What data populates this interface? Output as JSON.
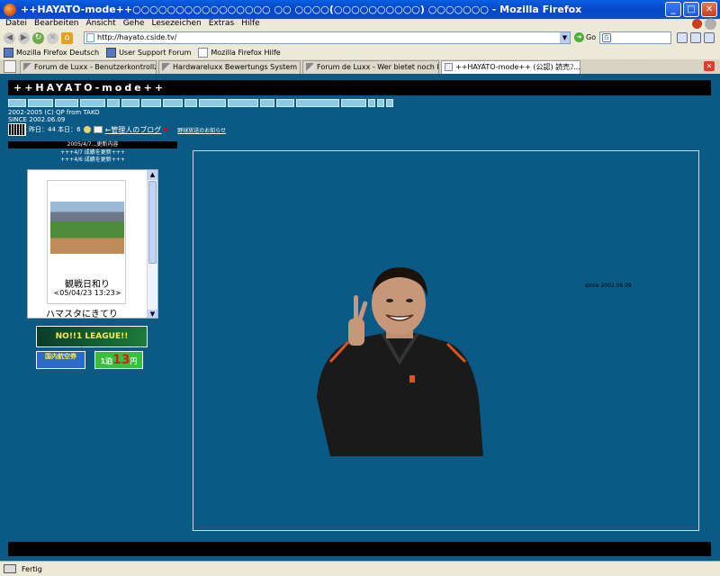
{
  "window": {
    "title": "++HAYATO-mode++○○○○○○○○○○○○○○○○ ○○ ○○○○(○○○○○○○○○○) ○○○○○○○ - Mozilla Firefox",
    "minimize": "_",
    "maximize": "□",
    "close": "✕"
  },
  "menu": [
    "Datei",
    "Bearbeiten",
    "Ansicht",
    "Gehe",
    "Lesezeichen",
    "Extras",
    "Hilfe"
  ],
  "nav": {
    "url": "http://hayato.cside.tv/",
    "go_label": "Go"
  },
  "bookmarks": [
    "Mozilla Firefox Deutsch",
    "User Support Forum",
    "Mozilla Firefox Hilfe"
  ],
  "tabs": [
    {
      "label": "Forum de Luxx - Benutzerkontrollzentrum"
    },
    {
      "label": "Hardwareluxx Bewertungs System"
    },
    {
      "label": "Forum de Luxx - Wer bietet noch DSL light an?"
    },
    {
      "label": "++HAYATO-mode++ (公認) 読売ﾌ..."
    }
  ],
  "site": {
    "title": "++HAYATO-mode++",
    "navlinks": [
      "",
      "",
      "",
      "",
      "",
      "",
      "",
      "",
      "",
      "",
      "",
      "",
      "",
      "",
      "",
      "",
      "",
      ""
    ],
    "copyright1": "2002-2005 (C) QP from TAKO",
    "copyright2": "SINCE 2002.06.09",
    "counter_text": "昨日：44 本日：6",
    "blog_link": "←管理人のブログ",
    "notice_link": "野球放送のお知らせ",
    "update_header": "2005/4/7...更新内容",
    "update_lines": [
      "+++4/7 成績を更新+++",
      "+++4/6 成績を更新+++"
    ],
    "side_caption1": "観戦日和り",
    "side_caption2": "<05/04/23 13:23>",
    "side_caption3": "ハマスタにきてり",
    "banner1_text": "NO!!1 LEAGUE!!",
    "banner2_text": "国内航空券",
    "banner3_prefix": "1泊",
    "banner3_number": "13",
    "banner3_suffix": "円",
    "since_text": "since 2002.06.09"
  },
  "status": {
    "text": "Fertig"
  }
}
